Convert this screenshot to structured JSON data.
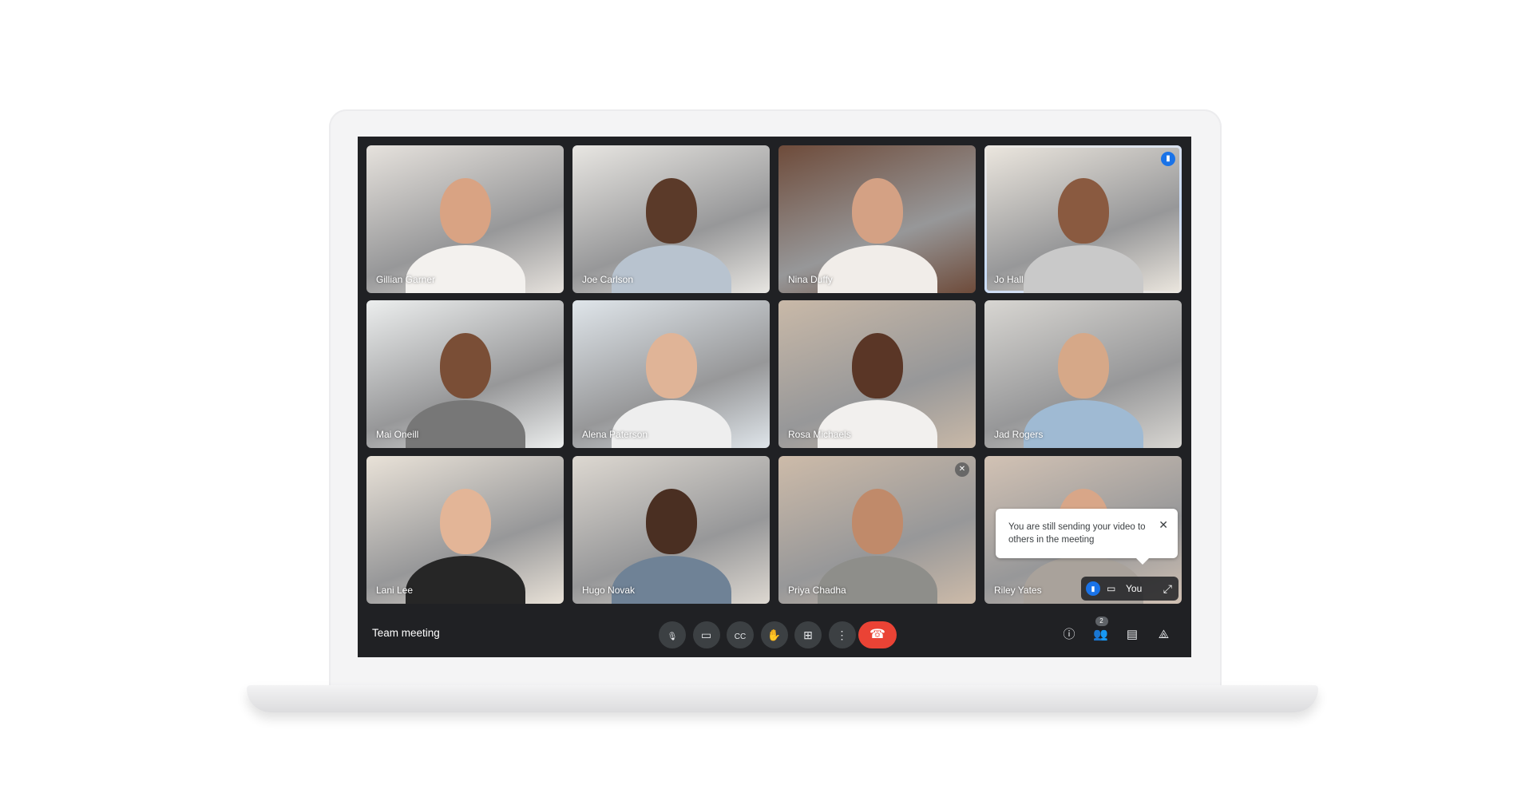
{
  "meeting": {
    "title": "Team meeting"
  },
  "participants": [
    {
      "name": "Gillian Garner",
      "bg": "#e6e2dd",
      "skin": "#d9a383",
      "shirt": "#f3f1ee"
    },
    {
      "name": "Joe Carlson",
      "bg": "#e8e6e2",
      "skin": "#5b3a29",
      "shirt": "#b8c3cf"
    },
    {
      "name": "Nina Duffy",
      "bg": "#6e4b3a",
      "skin": "#d4a184",
      "shirt": "#f1ede9"
    },
    {
      "name": "Jo Hall",
      "bg": "#ece7df",
      "skin": "#8a5a40",
      "shirt": "#c9c9c9",
      "speaking": true
    },
    {
      "name": "Mai Oneill",
      "bg": "#eceeee",
      "skin": "#7a4e36",
      "shirt": "#777"
    },
    {
      "name": "Alena Paterson",
      "bg": "#dfe5ea",
      "skin": "#e0b497",
      "shirt": "#eee"
    },
    {
      "name": "Rosa Michaels",
      "bg": "#c9b9a8",
      "skin": "#5a3626",
      "shirt": "#f2f0ee"
    },
    {
      "name": "Jad Rogers",
      "bg": "#d8d6d2",
      "skin": "#d6a888",
      "shirt": "#9fbad3"
    },
    {
      "name": "Lani Lee",
      "bg": "#e9e2d8",
      "skin": "#e3b597",
      "shirt": "#262626"
    },
    {
      "name": "Hugo Novak",
      "bg": "#ddd8d1",
      "skin": "#4a2f22",
      "shirt": "#6f8296"
    },
    {
      "name": "Priya Chadha",
      "bg": "#cdbba9",
      "skin": "#c08a6a",
      "shirt": "#8e8e8a",
      "muted": true
    },
    {
      "name": "Riley Yates",
      "bg": "#d2c2b4",
      "skin": "#d8a688",
      "shirt": "#a9a29b"
    }
  ],
  "self_tile": {
    "label": "You",
    "tooltip": "You are still sending your video to others in the meeting"
  },
  "controls": {
    "buttons": [
      {
        "icon": "microphone-icon",
        "glyph": "🎙"
      },
      {
        "icon": "camera-icon",
        "glyph": "▭"
      },
      {
        "icon": "captions-icon",
        "glyph": "CC"
      },
      {
        "icon": "raise-hand-icon",
        "glyph": "✋"
      },
      {
        "icon": "present-screen-icon",
        "glyph": "⊞"
      },
      {
        "icon": "more-options-icon",
        "glyph": "⋮"
      }
    ],
    "end_call": {
      "icon": "hang-up-icon",
      "glyph": "☎",
      "color": "#ea4335"
    },
    "right": [
      {
        "icon": "info-icon",
        "glyph": "ⓘ"
      },
      {
        "icon": "people-icon",
        "glyph": "👥",
        "badge": "2"
      },
      {
        "icon": "chat-icon",
        "glyph": "▤"
      },
      {
        "icon": "activities-icon",
        "glyph": "⟁"
      }
    ]
  },
  "colors": {
    "accent": "#1a73e8",
    "active_border": "#8ab4f8",
    "bar": "#202124"
  }
}
